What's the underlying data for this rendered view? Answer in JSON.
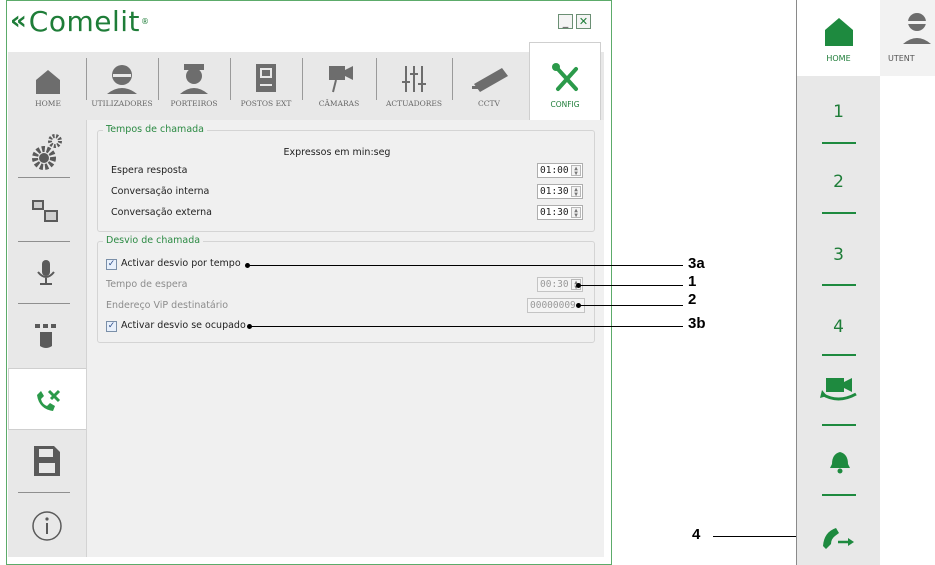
{
  "app": {
    "logo_text": "Comelit",
    "logo_reg": "®",
    "minimize": "_",
    "close": "✕"
  },
  "tabs": [
    {
      "label": "HOME",
      "icon": "home-icon"
    },
    {
      "label": "UTILIZADORES",
      "icon": "user-icon"
    },
    {
      "label": "PORTEIROS",
      "icon": "doorman-icon"
    },
    {
      "label": "POSTOS EXT",
      "icon": "entrance-panel-icon"
    },
    {
      "label": "CÂMARAS",
      "icon": "camera-icon"
    },
    {
      "label": "ACTUADORES",
      "icon": "actuator-icon"
    },
    {
      "label": "CCTV",
      "icon": "cctv-icon"
    },
    {
      "label": "CONFIG",
      "icon": "config-icon",
      "selected": true
    }
  ],
  "sidebar": [
    {
      "icon": "gears-icon"
    },
    {
      "icon": "devices-icon"
    },
    {
      "icon": "microphone-icon"
    },
    {
      "icon": "keypad-hand-icon"
    },
    {
      "icon": "call-divert-icon",
      "selected": true
    },
    {
      "icon": "save-icon"
    },
    {
      "icon": "info-icon"
    }
  ],
  "call_times": {
    "title": "Tempos de chamada",
    "note": "Expressos em min:seg",
    "rows": [
      {
        "label": "Espera resposta",
        "value": "01:00"
      },
      {
        "label": "Conversação interna",
        "value": "01:30"
      },
      {
        "label": "Conversação externa",
        "value": "01:30"
      }
    ]
  },
  "call_divert": {
    "title": "Desvio de chamada",
    "timed_divert": {
      "label": "Activar desvio por tempo",
      "checked": true
    },
    "wait_time": {
      "label": "Tempo de espera",
      "value": "00:30"
    },
    "vip_address": {
      "label": "Endereço ViP destinatário",
      "value": "00000009"
    },
    "busy_divert": {
      "label": "Activar desvio se ocupado",
      "checked": true
    }
  },
  "callouts": [
    "3a",
    "1",
    "2",
    "3b",
    "4"
  ],
  "right_panel": {
    "home_label": "HOME",
    "user_label": "UTENT",
    "numbers": [
      "1",
      "2",
      "3",
      "4"
    ],
    "icons": [
      "home-icon",
      "user-icon",
      "camera-cycle-icon",
      "bell-icon",
      "call-forward-icon"
    ],
    "accent": "#1e8a3f"
  }
}
